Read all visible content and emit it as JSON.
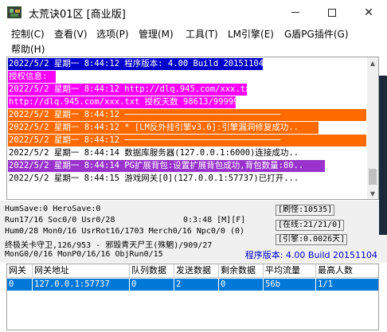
{
  "window": {
    "title": "太荒诀01区 [商业版]",
    "minimize_icon": "minimize-icon",
    "maximize_icon": "maximize-icon",
    "close_glyph": "✕"
  },
  "menu": [
    "控制(C)",
    "查看(V)",
    "选项(P)",
    "管理(M)",
    "工具(T)",
    "LM引擎(E)",
    "G盾PG插件(G)",
    "帮助(H)"
  ],
  "log": [
    {
      "text": "2022/5/2 星期一 8:44:12 程序版本: 4.00 Build 20151104",
      "bg": "#0000cc",
      "fg": "#ffffff"
    },
    {
      "text": "授权信息:",
      "bg": "#ff00ff",
      "fg": "#ffffff"
    },
    {
      "text": "2022/5/2 星期一 8:44:12 http://dlq.945.com/xxx.txt",
      "bg": "#ff00ff",
      "fg": "#ffffff"
    },
    {
      "text": "http://dlq.945.com/xxx.txt 授权天数 98613/99999",
      "bg": "#ff00ff",
      "fg": "#ffffff"
    },
    {
      "text": "2022/5/2 星期一 8:44:12 ───────────────────────────────",
      "bg": "#ff6a00",
      "fg": "#ffffff"
    },
    {
      "text": "2022/5/2 星期一 8:44:12 * [LM反外挂引擎v3.6]:引擎漏洞修复成功..",
      "bg": "#ff6a00",
      "fg": "#ffffff"
    },
    {
      "text": "2022/5/2 星期一 8:44:12 ───────────────────────────────",
      "bg": "#ff6a00",
      "fg": "#ffffff"
    },
    {
      "text": "2022/5/2 星期一 8:44:14 数据库服务器(127.0.0.1:6000)连接成功..",
      "bg": "#ffffff",
      "fg": "#000000"
    },
    {
      "text": "2022/5/2 星期一 8:44:14 PG扩展背包:设置扩展背包成功,背包数量:80..",
      "bg": "#9933cc",
      "fg": "#ffffff"
    },
    {
      "text": "2022/5/2 星期一 8:44:15 游戏网关[0](127.0.0.1:57737)已打开...",
      "bg": "#ffffff",
      "fg": "#000000"
    }
  ],
  "status": {
    "line1": "HumSave:0 HeroSave:0",
    "line2": "Run17/16 Soc0/0 Usr0/28",
    "line3": "Hum0/28 Mon0/16 UsrRot16/1703 Merch0/16 Npc0/0 (0)",
    "line4": "终极关卡守卫,126/953 - 邪毁青天尸王(殊魍)/909/27",
    "line5": "MonG0/0/16 MonP0/16/16 ObjRun0/15",
    "runtime": "0:3:48 [M][F]",
    "refresh": "[刷怪:10535]",
    "online": "[在线:21/21/0]",
    "engine": "[引擎:0.0026天]",
    "version": "程序版本: 4.00 Build 20151104"
  },
  "table": {
    "headers": [
      "网关",
      "网关地址",
      "队列数据",
      "发送数据",
      "剩余数据",
      "平均流量",
      "最高人数"
    ],
    "rows": [
      [
        "0",
        "127.0.0.1:57737",
        "0",
        "2",
        "0",
        "56b",
        "1/1"
      ]
    ]
  },
  "colors": {
    "selection": "#0078d7",
    "version_text": "#0000cc"
  }
}
